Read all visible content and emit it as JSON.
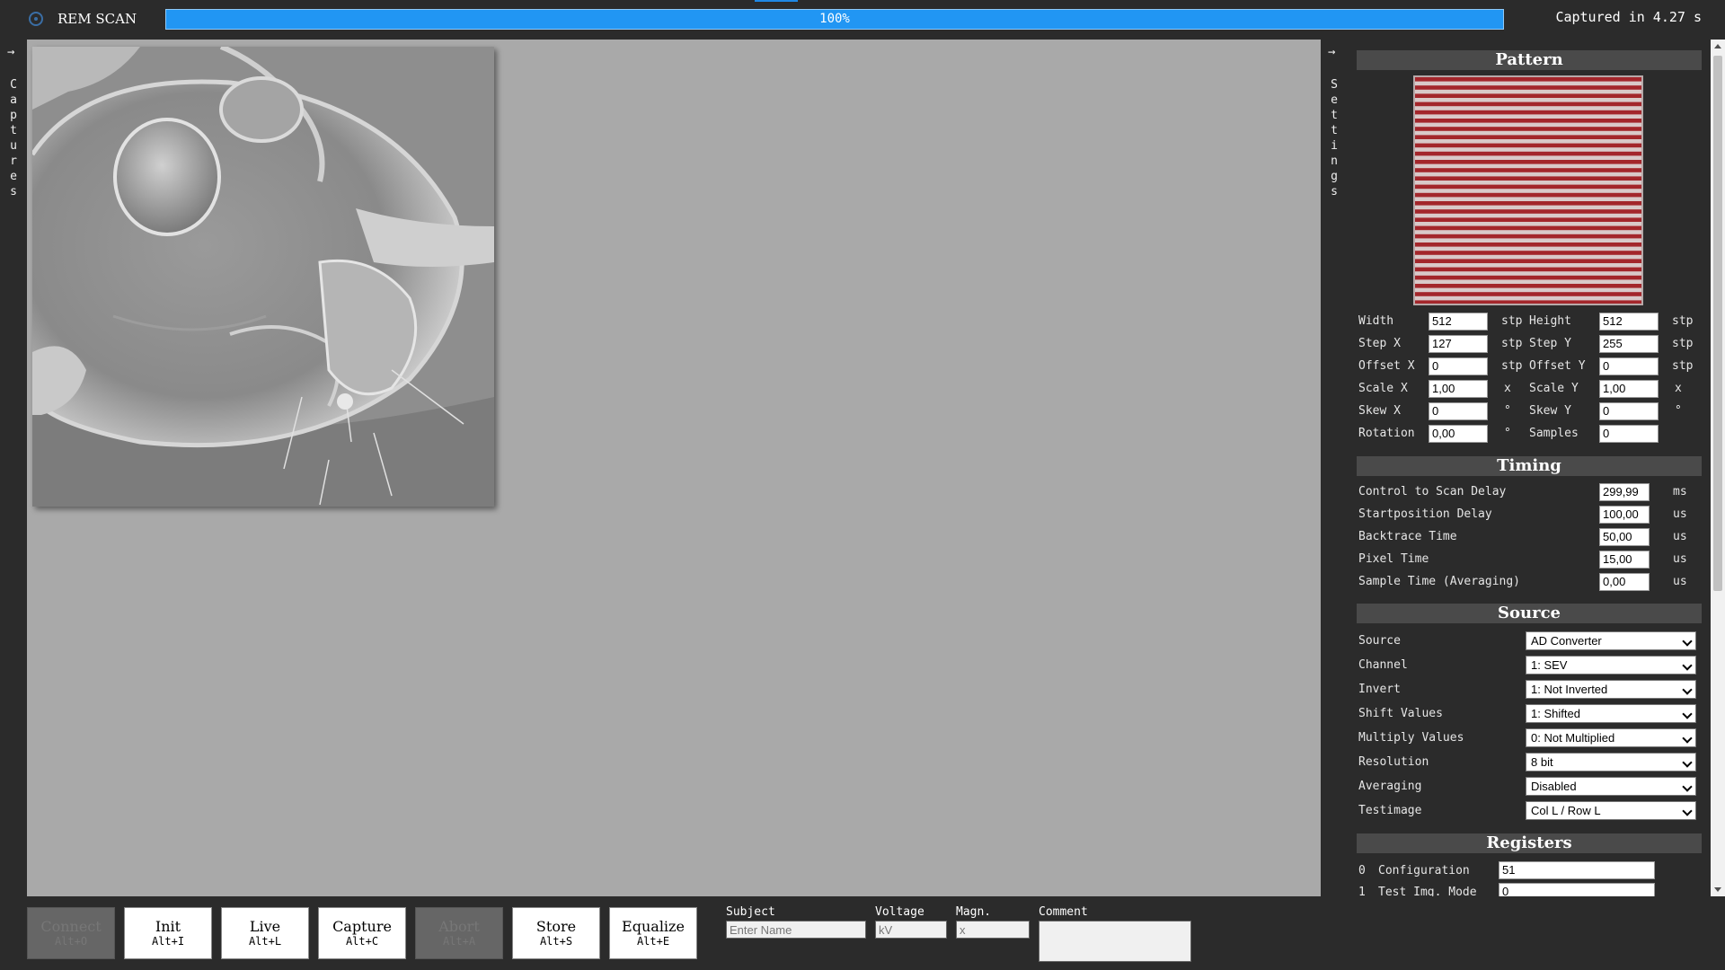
{
  "app": {
    "title": "REM SCAN"
  },
  "progress": {
    "text": "100%",
    "fraction": 1.0
  },
  "status": {
    "capture_time": "Captured in 4.27 s"
  },
  "left_panel": {
    "toggle_arrow": "→",
    "label_chars": [
      "C",
      "a",
      "p",
      "t",
      "u",
      "r",
      "e",
      "s"
    ]
  },
  "right_panel": {
    "toggle_arrow": "→",
    "label_chars": [
      "S",
      "e",
      "t",
      "t",
      "i",
      "n",
      "g",
      "s"
    ]
  },
  "pattern": {
    "header": "Pattern",
    "width_label": "Width",
    "width_value": "512",
    "width_unit": "stp",
    "height_label": "Height",
    "height_value": "512",
    "height_unit": "stp",
    "stepx_label": "Step X",
    "stepx_value": "127",
    "stepx_unit": "stp",
    "stepy_label": "Step Y",
    "stepy_value": "255",
    "stepy_unit": "stp",
    "offsetx_label": "Offset X",
    "offsetx_value": "0",
    "offsetx_unit": "stp",
    "offsety_label": "Offset Y",
    "offsety_value": "0",
    "offsety_unit": "stp",
    "scalex_label": "Scale X",
    "scalex_value": "1,00",
    "scalex_unit": "x",
    "scaley_label": "Scale Y",
    "scaley_value": "1,00",
    "scaley_unit": "x",
    "skewx_label": "Skew X",
    "skewx_value": "0",
    "skewx_unit": "°",
    "skewy_label": "Skew Y",
    "skewy_value": "0",
    "skewy_unit": "°",
    "rotation_label": "Rotation",
    "rotation_value": "0,00",
    "rotation_unit": "°",
    "samples_label": "Samples",
    "samples_value": "0"
  },
  "timing": {
    "header": "Timing",
    "control_label": "Control to Scan Delay",
    "control_value": "299,99",
    "control_unit": "ms",
    "startpos_label": "Startposition Delay",
    "startpos_value": "100,00",
    "startpos_unit": "us",
    "backtrace_label": "Backtrace Time",
    "backtrace_value": "50,00",
    "backtrace_unit": "us",
    "pixel_label": "Pixel Time",
    "pixel_value": "15,00",
    "pixel_unit": "us",
    "sample_label": "Sample Time (Averaging)",
    "sample_value": "0,00",
    "sample_unit": "us"
  },
  "source": {
    "header": "Source",
    "source_label": "Source",
    "source_value": "AD Converter",
    "channel_label": "Channel",
    "channel_value": "1: SEV",
    "invert_label": "Invert",
    "invert_value": "1: Not Inverted",
    "shift_label": "Shift Values",
    "shift_value": "1: Shifted",
    "multiply_label": "Multiply Values",
    "multiply_value": "0: Not Multiplied",
    "resolution_label": "Resolution",
    "resolution_value": "8 bit",
    "averaging_label": "Averaging",
    "averaging_value": "Disabled",
    "testimage_label": "Testimage",
    "testimage_value": "Col L / Row L"
  },
  "registers": {
    "header": "Registers",
    "r0_index": "0",
    "r0_label": "Configuration",
    "r0_value": "51",
    "r1_index": "1",
    "r1_label": "Test Img. Mode",
    "r1_value": "0"
  },
  "buttons": {
    "connect_label": "Connect",
    "connect_key": "Alt+O",
    "init_label": "Init",
    "init_key": "Alt+I",
    "live_label": "Live",
    "live_key": "Alt+L",
    "capture_label": "Capture",
    "capture_key": "Alt+C",
    "abort_label": "Abort",
    "abort_key": "Alt+A",
    "store_label": "Store",
    "store_key": "Alt+S",
    "equalize_label": "Equalize",
    "equalize_key": "Alt+E"
  },
  "fields": {
    "subject_label": "Subject",
    "subject_placeholder": "Enter Name",
    "voltage_label": "Voltage",
    "voltage_placeholder": "kV",
    "magn_label": "Magn.",
    "magn_placeholder": "x",
    "comment_label": "Comment"
  },
  "colors": {
    "accent": "#2196f3",
    "pattern_red": "#a3262b",
    "pattern_light": "#d9c9c9",
    "viewer_bg": "#a9a9a9"
  }
}
